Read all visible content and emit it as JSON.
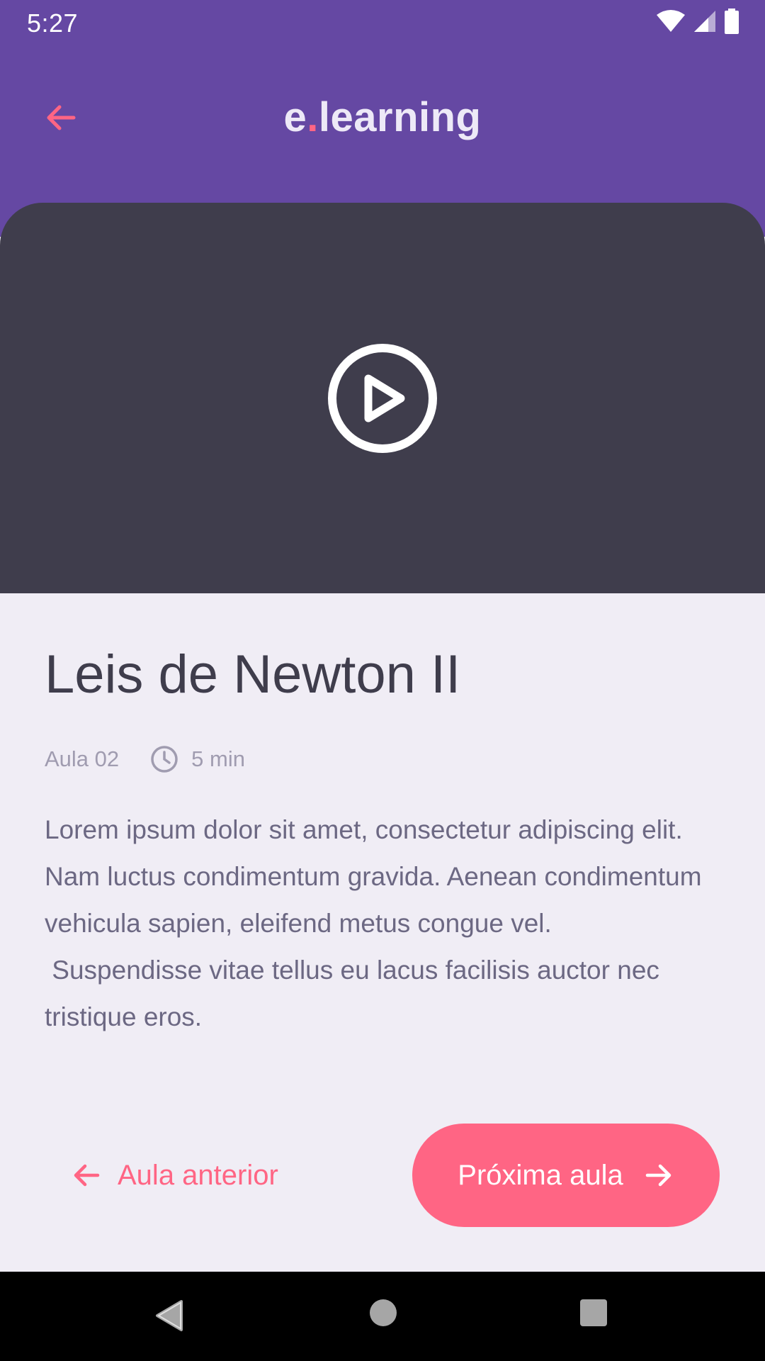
{
  "status_bar": {
    "time": "5:27"
  },
  "header": {
    "logo_prefix": "e",
    "logo_dot": ".",
    "logo_suffix": "learning"
  },
  "lesson": {
    "title": "Leis de Newton II",
    "number": "Aula 02",
    "duration": "5 min",
    "description": "Lorem ipsum dolor sit amet, consectetur adipiscing elit. Nam luctus condimentum gravida. Aenean condimentum vehicula sapien, eleifend metus congue vel.\n Suspendisse vitae tellus eu lacus facilisis auctor nec tristique eros."
  },
  "actions": {
    "previous_label": "Aula anterior",
    "next_label": "Próxima aula"
  },
  "colors": {
    "primary": "#6548A3",
    "accent": "#FF6584",
    "video_bg": "#3F3D4C",
    "page_bg": "#F0EDF5"
  }
}
